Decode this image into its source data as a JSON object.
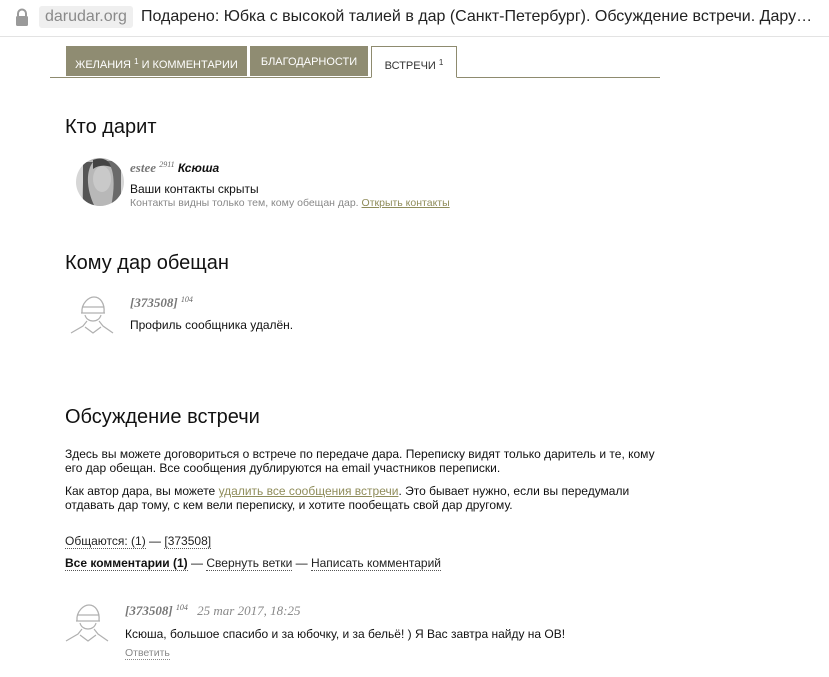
{
  "browser": {
    "domain": "darudar.org",
    "page_title": "Подарено: Юбка с высокой талией в дар (Санкт-Петербург). Обсуждение встречи. Дару…"
  },
  "tabs": [
    {
      "label": "Желания",
      "count": "1",
      "label2": " и комментарии"
    },
    {
      "label": "Благодарности"
    },
    {
      "label": "Встречи",
      "count": "1"
    }
  ],
  "giver": {
    "heading": "Кто дарит",
    "username": "estee",
    "karma": "2911",
    "real_name": "Ксюша",
    "contacts_hidden": "Ваши контакты скрыты",
    "contacts_note": "Контакты видны только тем, кому обещан дар.",
    "open_contacts": "Открыть контакты"
  },
  "promised": {
    "heading": "Кому дар обещан",
    "username": "[373508]",
    "karma": "104",
    "status": "Профиль сообщника удалён."
  },
  "discussion": {
    "heading": "Обсуждение встречи",
    "para1_line1": "Здесь вы можете договориться о встрече по передаче дара. Переписку видят только даритель и те, кому",
    "para1_line2": "его дар обещан. Все сообщения дублируются на email участников переписки.",
    "para2_prefix": "Как автор дара, вы можете ",
    "para2_link": "удалить все сообщения встречи",
    "para2_suffix": ". Это бывает нужно, если вы передумали",
    "para2_line2": "отдавать дар тому, с кем вели переписку, и хотите пообещать свой дар другому.",
    "talking_label": "Общаются: (1)",
    "talking_sep": " — ",
    "talking_user": "[373508]",
    "all_comments": "Все комментарии (1)",
    "sep1": " — ",
    "collapse": "Свернуть ветки",
    "sep2": " — ",
    "write": "Написать комментарий"
  },
  "comment": {
    "username": "[373508]",
    "karma": "104",
    "date": "25 mar 2017, 18:25",
    "text": "Ксюша, большое спасибо и за юбочку, и за бельё! ) Я Вас завтра найду на ОВ!",
    "reply": "Ответить"
  }
}
